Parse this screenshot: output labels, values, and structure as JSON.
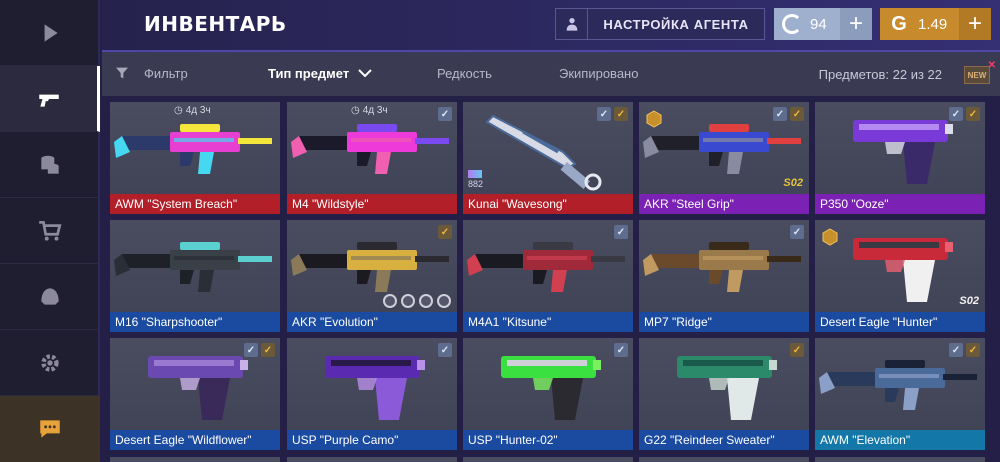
{
  "header": {
    "title": "ИНВЕНТАРЬ",
    "agent_button": "НАСТРОЙКА АГЕНТА",
    "currency_silver": "94",
    "currency_gold": "1.49",
    "currency_gold_symbol": "G"
  },
  "filters": {
    "filter_label": "Фильтр",
    "type_label": "Тип предмет",
    "rarity_label": "Редкость",
    "equipped_label": "Экипировано",
    "count_label": "Предметов: 22 из 22",
    "new_badge": "NEW"
  },
  "sidebar": {
    "items": [
      "play-icon",
      "pistol-icon",
      "coins-icon",
      "cart-icon",
      "helmet-icon",
      "gear-icon",
      "chat-icon"
    ]
  },
  "items": [
    {
      "name": "AWM \"System Breach\"",
      "rarity": "red",
      "timer": "4д 3ч",
      "checks": [],
      "colors": [
        "#2b3a6b",
        "#e63fd2",
        "#f4e63a",
        "#45d8f0"
      ]
    },
    {
      "name": "M4 \"Wildstyle\"",
      "rarity": "red",
      "timer": "4д 3ч",
      "checks": [
        "blue"
      ],
      "colors": [
        "#1a1a2a",
        "#ee3ad8",
        "#7a4af0",
        "#f05fb0"
      ]
    },
    {
      "name": "Kunai \"Wavesong\"",
      "rarity": "red",
      "badge": "882",
      "checks": [
        "blue",
        "gold"
      ],
      "colors": [
        "#d8dae6",
        "#4a6a9a",
        "#9aa8c8",
        "#e8e8f0"
      ]
    },
    {
      "name": "AKR \"Steel Grip\"",
      "rarity": "purple",
      "tag": "S02",
      "tag_color": "gold",
      "sticker": true,
      "checks": [
        "blue",
        "gold"
      ],
      "colors": [
        "#20202a",
        "#3a4ad0",
        "#e04040",
        "#8a8aa0"
      ]
    },
    {
      "name": "P350 \"Ooze\"",
      "rarity": "purple",
      "checks": [
        "blue",
        "gold"
      ],
      "colors": [
        "#7a3ad8",
        "#3a2a6a",
        "#b58af0",
        "#dcdcea"
      ]
    },
    {
      "name": "M16 \"Sharpshooter\"",
      "rarity": "blue",
      "checks": [],
      "colors": [
        "#1e2228",
        "#3a4048",
        "#5ad0d0",
        "#2a2e36"
      ]
    },
    {
      "name": "AKR \"Evolution\"",
      "rarity": "blue",
      "charms": 4,
      "checks": [
        "gold"
      ],
      "colors": [
        "#1a1a20",
        "#d8b040",
        "#2a2a30",
        "#8a7a5a"
      ]
    },
    {
      "name": "M4A1 \"Kitsune\"",
      "rarity": "blue",
      "checks": [
        "blue"
      ],
      "colors": [
        "#1a1a22",
        "#a02a3a",
        "#3a3a44",
        "#d04050"
      ]
    },
    {
      "name": "MP7 \"Ridge\"",
      "rarity": "blue",
      "checks": [
        "blue"
      ],
      "colors": [
        "#6a4a2a",
        "#9a7a4a",
        "#3a2a1a",
        "#c09a60"
      ]
    },
    {
      "name": "Desert Eagle \"Hunter\"",
      "rarity": "blue",
      "tag": "S02",
      "tag_color": "white",
      "sticker": true,
      "checks": [],
      "colors": [
        "#c82a3a",
        "#f0f0f0",
        "#3a3a44",
        "#e86070"
      ]
    },
    {
      "name": "Desert Eagle \"Wildflower\"",
      "rarity": "blue",
      "checks": [
        "blue",
        "gold"
      ],
      "colors": [
        "#6a4ab0",
        "#3a2a5a",
        "#9a7ad0",
        "#c8b0e8"
      ]
    },
    {
      "name": "USP \"Purple Camo\"",
      "rarity": "blue",
      "checks": [
        "blue"
      ],
      "colors": [
        "#5a2ab0",
        "#8a5ad8",
        "#2a1a4a",
        "#b890e8"
      ]
    },
    {
      "name": "USP \"Hunter-02\"",
      "rarity": "blue",
      "checks": [
        "blue"
      ],
      "colors": [
        "#3ae040",
        "#2a2a30",
        "#d0d0d8",
        "#7af060"
      ]
    },
    {
      "name": "G22 \"Reindeer Sweater\"",
      "rarity": "blue",
      "checks": [
        "gold"
      ],
      "colors": [
        "#2a8a6a",
        "#e0e8e8",
        "#1a5a4a",
        "#c8d8d0"
      ]
    },
    {
      "name": "AWM \"Elevation\"",
      "rarity": "cyan",
      "checks": [
        "blue",
        "gold"
      ],
      "colors": [
        "#2a3a5a",
        "#4a6a9a",
        "#1a2238",
        "#8aa0c8"
      ]
    }
  ]
}
